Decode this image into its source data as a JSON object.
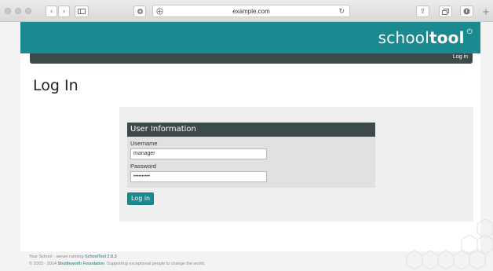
{
  "browser": {
    "url": "example.com",
    "new_tab_glyph": "+"
  },
  "site": {
    "logo_light": "school",
    "logo_bold": "tool",
    "logo_mark": "⏻",
    "nav_login": "Log in"
  },
  "login": {
    "page_title": "Log In",
    "section_title": "User Information",
    "username_label": "Username",
    "username_value": "manager",
    "password_label": "Password",
    "password_value": "••••••••••",
    "submit_label": "Log in"
  },
  "footer": {
    "line1_prefix": "Your School - server running ",
    "line1_link": "SchoolTool 2.8.3",
    "line2_prefix": "© 2003 - 2014 ",
    "line2_link": "Shuttleworth Foundation",
    "line2_suffix": ". Supporting exceptional people to change the world."
  },
  "colors": {
    "brand_teal": "#1a8a90",
    "nav_dark": "#3c4a4c"
  },
  "icons": [
    "sidebar-icon",
    "shield-icon",
    "compass-icon",
    "reload-icon",
    "share-icon",
    "tabs-icon",
    "download-icon"
  ]
}
